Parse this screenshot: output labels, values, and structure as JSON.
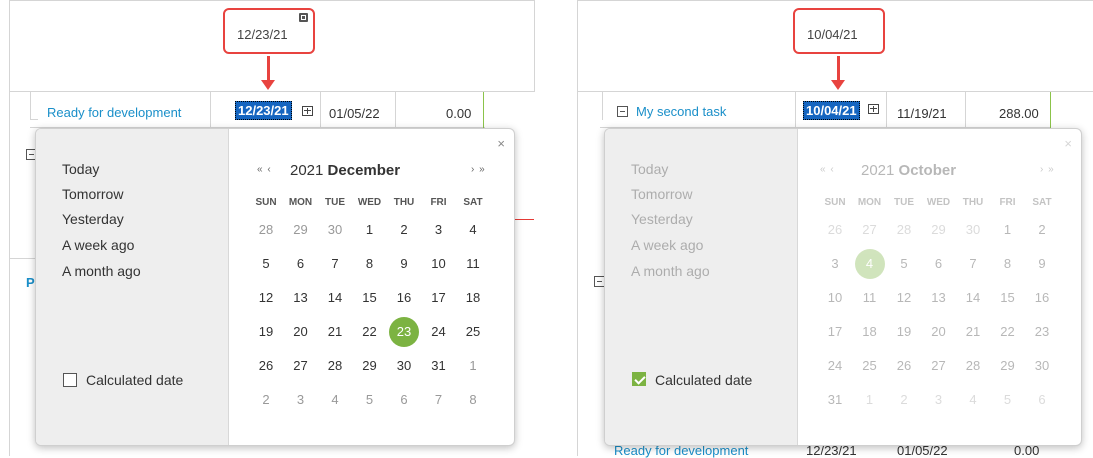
{
  "left": {
    "callout_date": "12/23/21",
    "row": {
      "task_label": "Ready for development",
      "start": "12/23/21",
      "end": "01/05/22",
      "value": "0.00"
    },
    "partial_label": "P",
    "calendar": {
      "shortcuts": [
        "Today",
        "Tomorrow",
        "Yesterday",
        "A week ago",
        "A month ago"
      ],
      "calculated_label": "Calculated date",
      "calculated_checked": false,
      "year": "2021",
      "month": "December",
      "nav_prev": "« ‹",
      "nav_next": "› »",
      "close": "×",
      "weekdays": [
        "SUN",
        "MON",
        "TUE",
        "WED",
        "THU",
        "FRI",
        "SAT"
      ],
      "weeks": [
        [
          "28",
          "29",
          "30",
          "1",
          "2",
          "3",
          "4"
        ],
        [
          "5",
          "6",
          "7",
          "8",
          "9",
          "10",
          "11"
        ],
        [
          "12",
          "13",
          "14",
          "15",
          "16",
          "17",
          "18"
        ],
        [
          "19",
          "20",
          "21",
          "22",
          "23",
          "24",
          "25"
        ],
        [
          "26",
          "27",
          "28",
          "29",
          "30",
          "31",
          "1"
        ],
        [
          "2",
          "3",
          "4",
          "5",
          "6",
          "7",
          "8"
        ]
      ],
      "selected_day": "23"
    }
  },
  "right": {
    "callout_date": "10/04/21",
    "row": {
      "task_label": "My second task",
      "start": "10/04/21",
      "end": "11/19/21",
      "value": "288.00"
    },
    "bottom_row": {
      "task_label": "Ready for development",
      "start": "12/23/21",
      "end": "01/05/22",
      "value": "0.00"
    },
    "calendar": {
      "shortcuts": [
        "Today",
        "Tomorrow",
        "Yesterday",
        "A week ago",
        "A month ago"
      ],
      "calculated_label": "Calculated date",
      "calculated_checked": true,
      "year": "2021",
      "month": "October",
      "nav_prev": "« ‹",
      "nav_next": "› »",
      "close": "×",
      "weekdays": [
        "SUN",
        "MON",
        "TUE",
        "WED",
        "THU",
        "FRI",
        "SAT"
      ],
      "weeks": [
        [
          "26",
          "27",
          "28",
          "29",
          "30",
          "1",
          "2"
        ],
        [
          "3",
          "4",
          "5",
          "6",
          "7",
          "8",
          "9"
        ],
        [
          "10",
          "11",
          "12",
          "13",
          "14",
          "15",
          "16"
        ],
        [
          "17",
          "18",
          "19",
          "20",
          "21",
          "22",
          "23"
        ],
        [
          "24",
          "25",
          "26",
          "27",
          "28",
          "29",
          "30"
        ],
        [
          "31",
          "1",
          "2",
          "3",
          "4",
          "5",
          "6"
        ]
      ],
      "selected_day": "4"
    }
  },
  "colors": {
    "callout_border": "#e8433f",
    "link": "#1a8fc9",
    "selected_day": "#7cb342",
    "selected_text_bg": "#1565c0"
  }
}
